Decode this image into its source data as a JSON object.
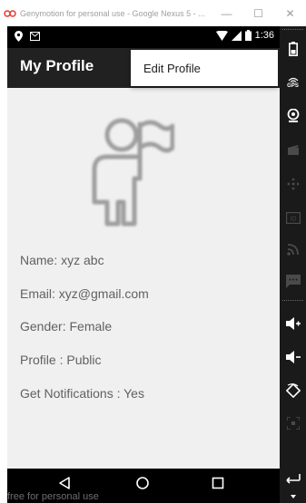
{
  "window": {
    "title": "Genymotion for personal use - Google Nexus 5 - ...",
    "minimize_glyph": "—",
    "maximize_glyph": "☐",
    "close_glyph": "✕"
  },
  "statusbar": {
    "time": "1:36"
  },
  "app": {
    "title": "My Profile",
    "menu_items": [
      {
        "label": "Edit Profile"
      }
    ]
  },
  "profile": {
    "fields": [
      {
        "text": "Name:  xyz abc"
      },
      {
        "text": "Email: xyz@gmail.com"
      },
      {
        "text": "Gender: Female"
      },
      {
        "text": "Profile : Public"
      },
      {
        "text": "Get Notifications : Yes"
      }
    ]
  },
  "watermark": "free for personal use",
  "toolbar": {
    "gps_label": "GPS",
    "id_label": "ID"
  },
  "colors": {
    "appbar": "#212121",
    "screen_bg": "#f0f0f0",
    "toolbar": "#1a1a1a",
    "text": "#616161"
  }
}
